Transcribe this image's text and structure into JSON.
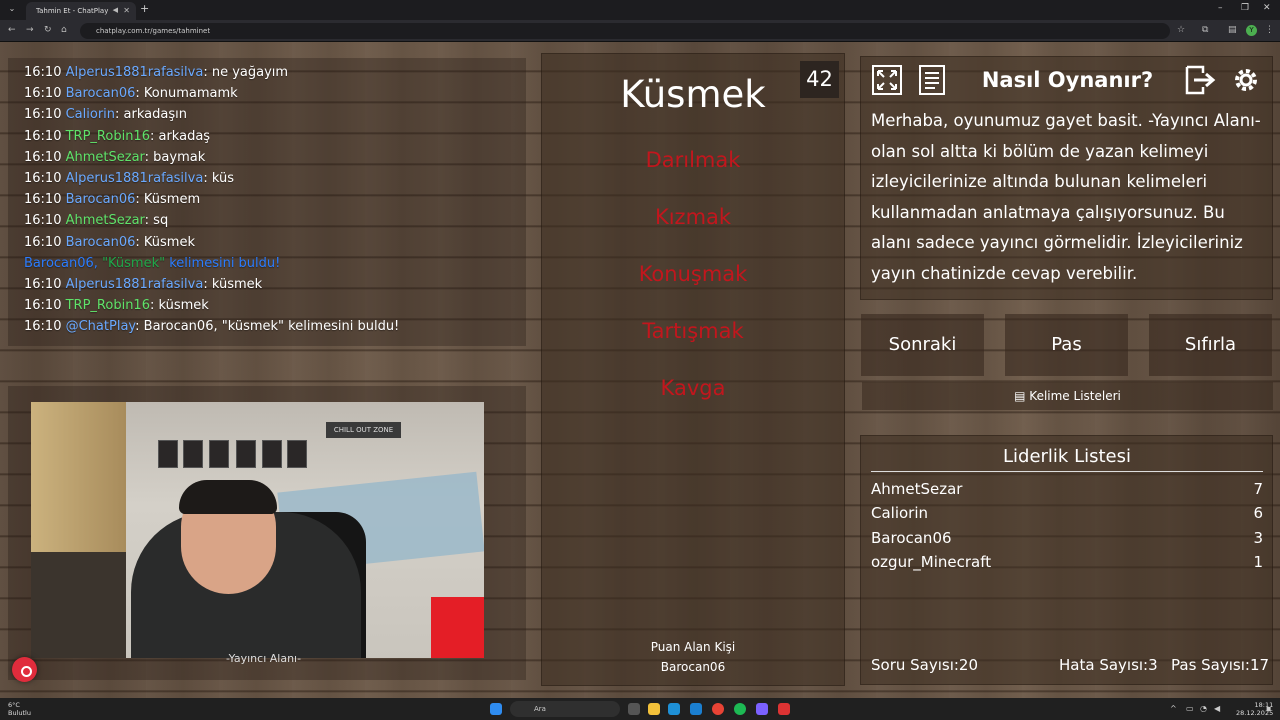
{
  "browser": {
    "tab_title": "Tahmin Et - ChatPlay",
    "url": "chatplay.com.tr/games/tahminet"
  },
  "chat": {
    "lines": [
      {
        "time": "16:10",
        "user": "Alperus1881rafasilva",
        "color": "#6aa9ff",
        "message": ": ne yağayım"
      },
      {
        "time": "16:10",
        "user": "Barocan06",
        "color": "#6aa9ff",
        "message": ": Konumamamk"
      },
      {
        "time": "16:10",
        "user": "Caliorin",
        "color": "#6aa9ff",
        "message": ": arkadaşın"
      },
      {
        "time": "16:10",
        "user": "TRP_Robin16",
        "color": "#5fe36a",
        "message": ": arkadaş"
      },
      {
        "time": "16:10",
        "user": "AhmetSezar",
        "color": "#5fe36a",
        "message": ": baymak"
      },
      {
        "time": "16:10",
        "user": "Alperus1881rafasilva",
        "color": "#6aa9ff",
        "message": ": küs"
      },
      {
        "time": "16:10",
        "user": "Barocan06",
        "color": "#6aa9ff",
        "message": ": Küsmem"
      },
      {
        "time": "16:10",
        "user": "AhmetSezar",
        "color": "#5fe36a",
        "message": ": sq"
      },
      {
        "time": "16:10",
        "user": "Barocan06",
        "color": "#6aa9ff",
        "message": ": Küsmek"
      },
      {
        "system": "Barocan06, ",
        "system_word": "\"Küsmek\"",
        "system_rest": " kelimesini buldu!"
      },
      {
        "time": "16:10",
        "user": "Alperus1881rafasilva",
        "color": "#6aa9ff",
        "message": ": küsmek"
      },
      {
        "time": "16:10",
        "user": "TRP_Robin16",
        "color": "#5fe36a",
        "message": ": küsmek"
      },
      {
        "time": "16:10",
        "user": "@ChatPlay",
        "color": "#6aa9ff",
        "message": ": Barocan06, \"küsmek\" kelimesini buldu!"
      }
    ]
  },
  "webcam": {
    "caption": "-Yayıncı Alanı-",
    "sign": "CHILL OUT ZONE"
  },
  "game": {
    "word": "Küsmek",
    "counter": "42",
    "forbidden_words": [
      "Darılmak",
      "Kızmak",
      "Konuşmak",
      "Tartışmak",
      "Kavga"
    ],
    "scorer_label": "Puan Alan Kişi",
    "scorer_name": "Barocan06"
  },
  "help": {
    "title": "Nasıl Oynanır?",
    "text": "Merhaba, oyunumuz gayet basit. -Yayıncı Alanı- olan sol altta ki bölüm de yazan kelimeyi izleyicilerinize altında bulunan kelimeleri kullanmadan anlatmaya çalışıyorsunuz. Bu alanı sadece yayıncı görmelidir. İzleyicileriniz yayın chatinizde cevap verebilir."
  },
  "controls": {
    "next": "Sonraki",
    "pass": "Pas",
    "reset": "Sıfırla",
    "word_lists": "Kelime Listeleri"
  },
  "leaderboard": {
    "title": "Liderlik Listesi",
    "rows": [
      {
        "name": "AhmetSezar",
        "score": "7"
      },
      {
        "name": "Caliorin",
        "score": "6"
      },
      {
        "name": "Barocan06",
        "score": "3"
      },
      {
        "name": "ozgur_Minecraft",
        "score": "1"
      }
    ]
  },
  "stats": {
    "questions": "Soru Sayısı:20",
    "errors": "Hata Sayısı:3",
    "passes": "Pas Sayısı:17"
  },
  "taskbar": {
    "weather_temp": "6°C",
    "weather_desc": "Bulutlu",
    "search": "Ara",
    "time": "18:11",
    "date": "28.12.2025"
  }
}
